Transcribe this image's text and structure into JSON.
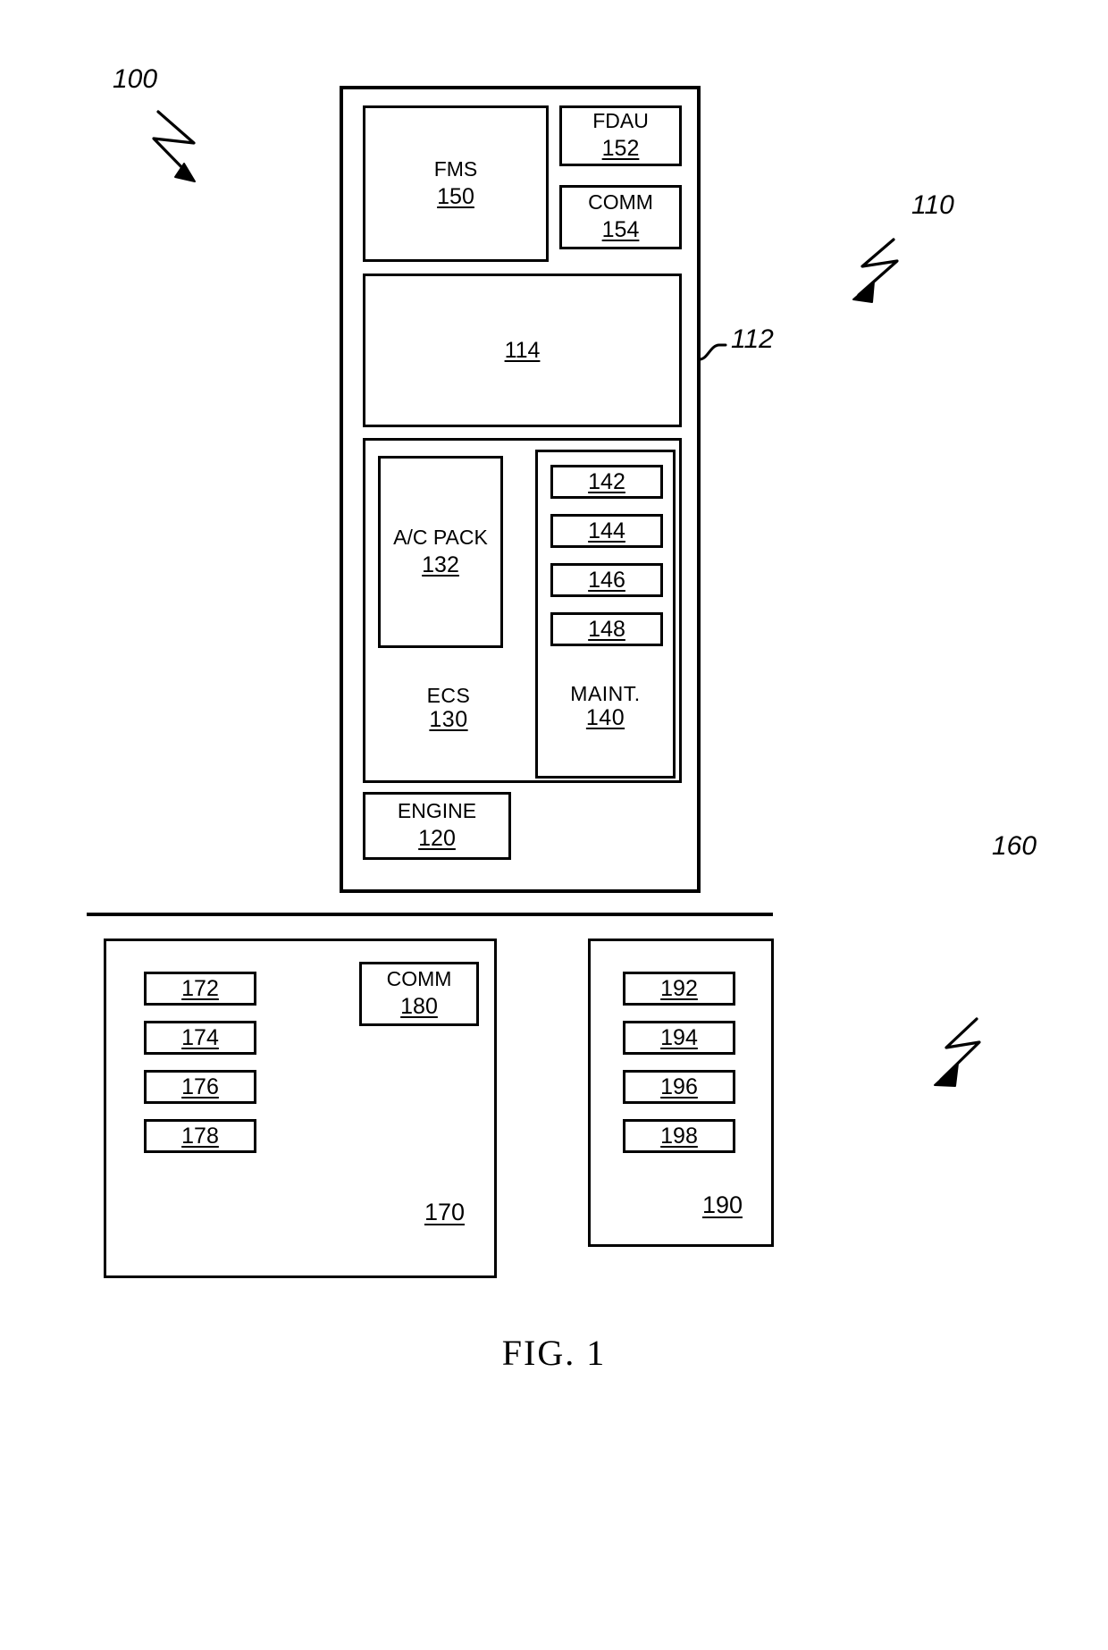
{
  "figure": {
    "caption": "FIG. 1",
    "system_ref": "100",
    "aircraft_ref": "110",
    "aircraft_inner_ref": "112",
    "ground_ref": "160"
  },
  "aircraft": {
    "inner_panel_ref": "114",
    "fms": {
      "name": "FMS",
      "num": "150"
    },
    "fdau": {
      "name": "FDAU",
      "num": "152"
    },
    "comm": {
      "name": "COMM",
      "num": "154"
    },
    "ecs": {
      "name": "ECS",
      "num": "130",
      "ac_pack": {
        "name": "A/C PACK",
        "num": "132"
      }
    },
    "maint": {
      "name": "MAINT.",
      "num": "140",
      "items": [
        "142",
        "144",
        "146",
        "148"
      ]
    },
    "engine": {
      "name": "ENGINE",
      "num": "120"
    }
  },
  "ground": {
    "left_station": {
      "num": "170",
      "items": [
        "172",
        "174",
        "176",
        "178"
      ],
      "comm": {
        "name": "COMM",
        "num": "180"
      }
    },
    "right_station": {
      "num": "190",
      "items": [
        "192",
        "194",
        "196",
        "198"
      ]
    }
  }
}
